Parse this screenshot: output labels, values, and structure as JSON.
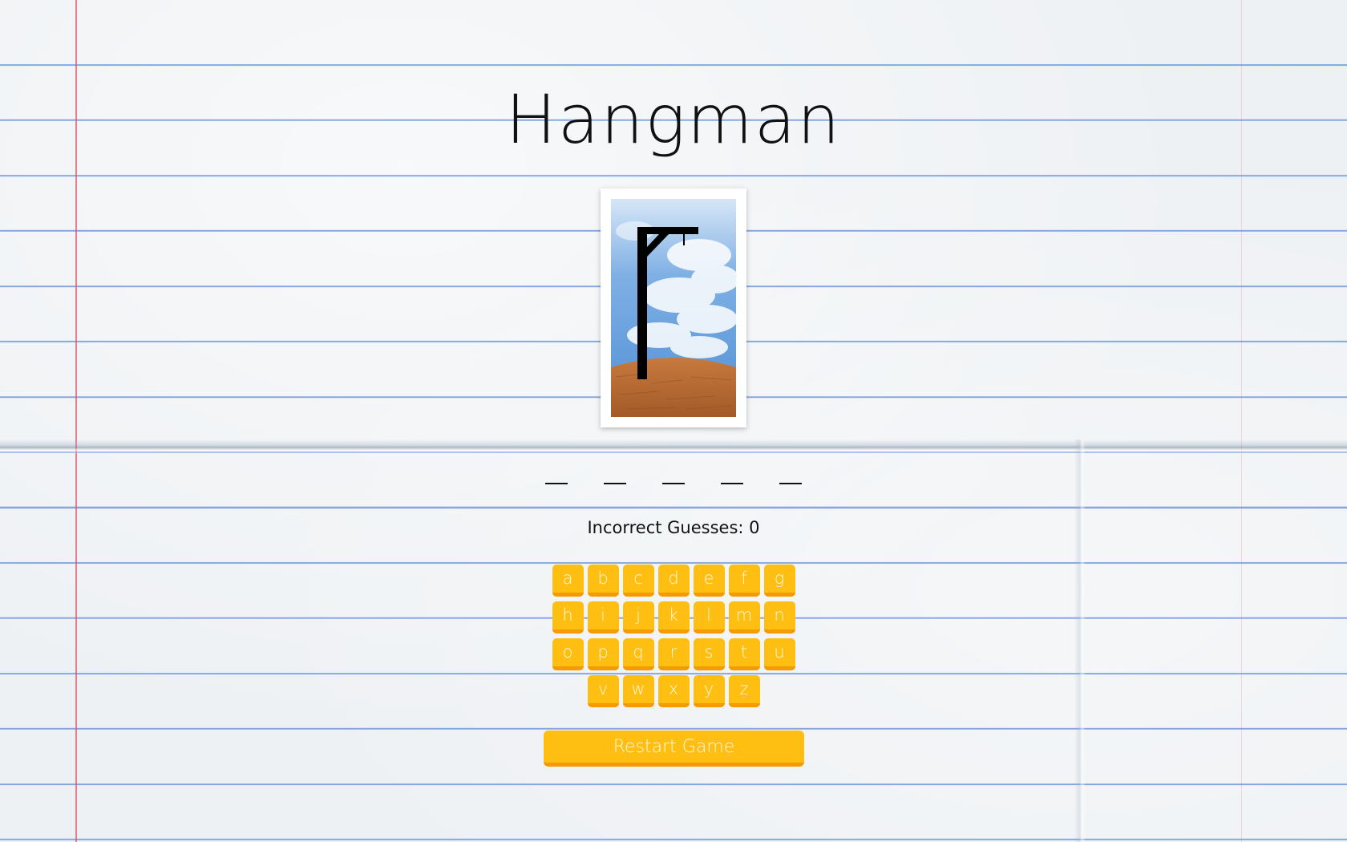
{
  "app": {
    "title": "Hangman"
  },
  "scene": {
    "image_name": "gallows-scene",
    "sky_color": "#6fa8e0",
    "ground_color": "#b86b35",
    "gallows_color": "#000000"
  },
  "word": {
    "blanks": [
      "_",
      "_",
      "_",
      "_",
      "_"
    ]
  },
  "status": {
    "incorrect_label": "Incorrect Guesses: 0"
  },
  "keyboard": {
    "rows": [
      [
        "a",
        "b",
        "c",
        "d",
        "e",
        "f",
        "g"
      ],
      [
        "h",
        "i",
        "j",
        "k",
        "l",
        "m",
        "n"
      ],
      [
        "o",
        "p",
        "q",
        "r",
        "s",
        "t",
        "u"
      ],
      [
        "v",
        "w",
        "x",
        "y",
        "z"
      ]
    ],
    "key_color": "#ffbe12",
    "key_shadow_color": "#f59a00"
  },
  "actions": {
    "restart_label": "Restart Game"
  }
}
